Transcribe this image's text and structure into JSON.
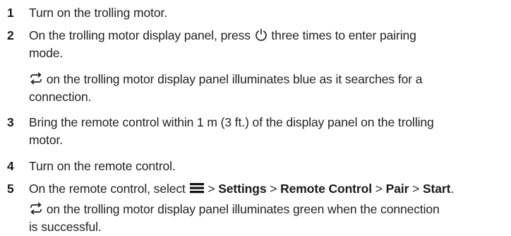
{
  "steps": [
    {
      "number": "1",
      "text": "Turn on the trolling motor."
    },
    {
      "number": "2",
      "text_before": "On the trolling motor display panel, press",
      "icon": "power-icon",
      "text_after_line1": " three times to enter pairing",
      "text_line2": "mode.",
      "note_line1": " on the trolling motor display panel illuminates blue as it searches for a",
      "note_line2": "connection.",
      "note_icon": "pairing-arrows-icon"
    },
    {
      "number": "3",
      "line1": "Bring the remote control within 1 m (3 ft.) of the display panel on the trolling",
      "line2": "motor."
    },
    {
      "number": "4",
      "text": "Turn on the remote control."
    },
    {
      "number": "5",
      "prefix": "On the remote control, select ",
      "menu_icon": "menu-icon",
      "sep": " > ",
      "path": [
        "Settings",
        "Remote Control",
        "Pair",
        "Start"
      ],
      "end": ".",
      "note_line1": " on the trolling motor display panel illuminates green when the connection",
      "note_line2": "is successful.",
      "note_icon": "pairing-arrows-icon"
    }
  ]
}
